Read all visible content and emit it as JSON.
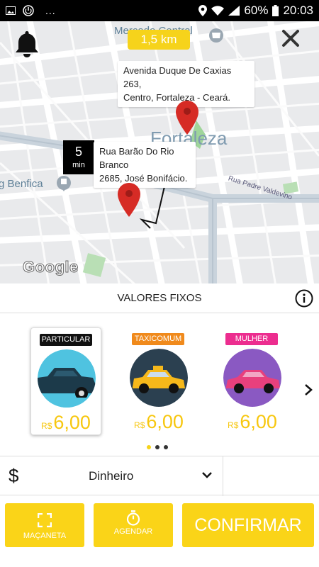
{
  "status_bar": {
    "battery": "60%",
    "time": "20:03",
    "dots": "..."
  },
  "map": {
    "distance": "1,5 km",
    "labels": {
      "mercado": "Mercado Central",
      "city": "Fortaleza",
      "benfica": "g Benfica",
      "street": "Rua Padre Valdevino"
    },
    "destination_line1": "Avenida Duque De Caxias 263,",
    "destination_line2": "Centro, Fortaleza - Ceará.",
    "origin_line1": "Rua Barão Do Rio Branco",
    "origin_line2": "2685, José Bonifácio.",
    "eta_value": "5",
    "eta_unit": "min",
    "google": "Google"
  },
  "fares": {
    "title": "VALORES FIXOS",
    "vehicles": [
      {
        "tag": "PARTICULAR",
        "currency": "R$",
        "price": "6,00",
        "tag_color": "#111111",
        "car_color": "#1c3a4a",
        "bg_color": "#4fc3e0"
      },
      {
        "tag": "TAXICOMUM",
        "currency": "R$",
        "price": "6,00",
        "tag_color": "#f08a1c",
        "car_color": "#f6b81a",
        "bg_color": "#2b4050"
      },
      {
        "tag": "MULHER",
        "currency": "R$",
        "price": "6,00",
        "tag_color": "#ec2d8f",
        "car_color": "#e8407d",
        "bg_color": "#8a59c2"
      }
    ]
  },
  "payment": {
    "method": "Dinheiro",
    "icon": "$"
  },
  "actions": {
    "macaneta": "MAÇANETA",
    "agendar": "AGENDAR",
    "confirmar": "CONFIRMAR"
  },
  "colors": {
    "accent": "#fad418",
    "price": "#f7c70f",
    "pin": "#d62b25"
  }
}
